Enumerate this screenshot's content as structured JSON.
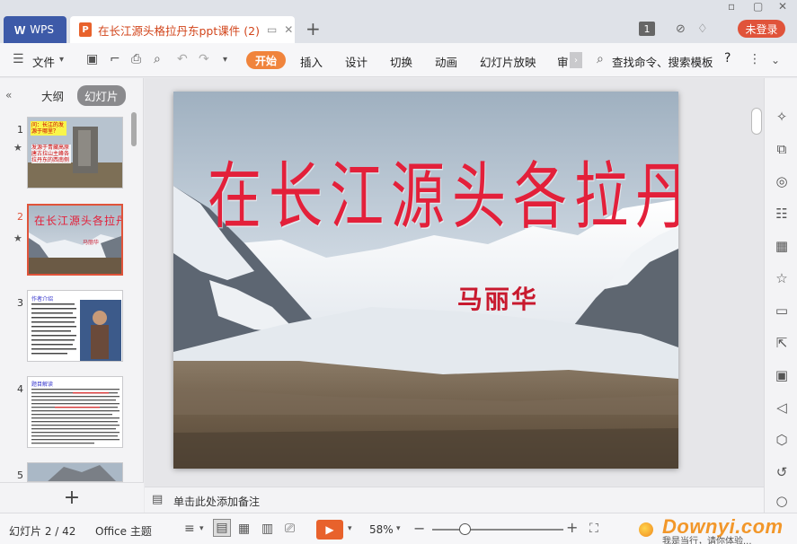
{
  "titlebar": {
    "app_tab": "WPS",
    "app_logo": "W",
    "doc_tab": "在长江源头格拉丹东ppt课件 (2)",
    "doc_icon": "P",
    "page_badge": "1",
    "login": "未登录"
  },
  "menubar": {
    "file": "文件",
    "tabs": [
      "开始",
      "插入",
      "设计",
      "切换",
      "动画",
      "幻灯片放映",
      "审"
    ],
    "search": "查找命令、搜索模板",
    "help": "?"
  },
  "leftpanel": {
    "tab_outline": "大纲",
    "tab_slides": "幻灯片",
    "thumbnails": [
      {
        "num": "1",
        "title": "问：长江的发源于哪里？",
        "body": "发源于青藏高原唐古拉山主峰各拉丹东的西南侧",
        "star": true
      },
      {
        "num": "2",
        "title": "在长江源头各拉丹东",
        "author": "马丽华",
        "star": true
      },
      {
        "num": "3",
        "title": "作者介绍"
      },
      {
        "num": "4",
        "title": "题目解读"
      },
      {
        "num": "5"
      }
    ]
  },
  "slide": {
    "title": "在长江源头各拉丹东",
    "author": "马丽华"
  },
  "notes": {
    "placeholder": "单击此处添加备注"
  },
  "statusbar": {
    "slide_count": "幻灯片 2 / 42",
    "theme": "Office 主题",
    "zoom": "58%",
    "watermark_brand": "Downyi.com",
    "watermark_sub": "我是当行，请你体验..."
  },
  "colors": {
    "accent": "#e8622c",
    "title_red": "#e3203a",
    "wps_blue": "#3d5aa8",
    "login_red": "#e0533a"
  }
}
